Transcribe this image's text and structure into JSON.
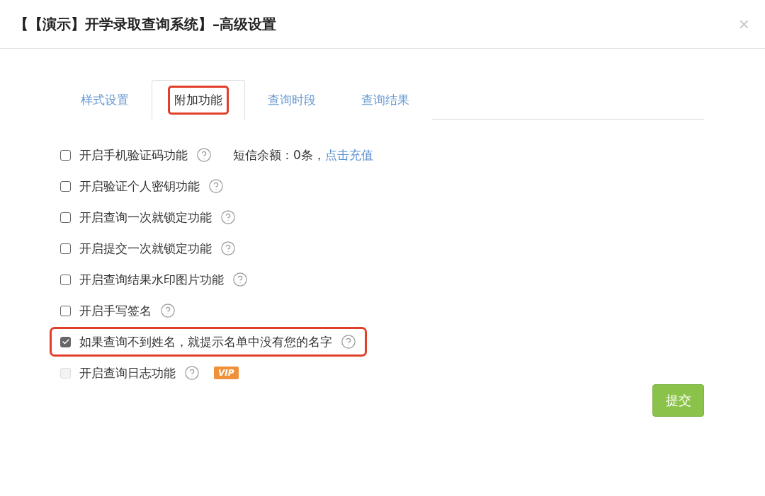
{
  "window": {
    "title": "【【演示】开学录取查询系统】–高级设置",
    "close": "×"
  },
  "tabs": [
    {
      "label": "样式设置",
      "selected": false,
      "highlighted": false
    },
    {
      "label": "附加功能",
      "selected": true,
      "highlighted": true
    },
    {
      "label": "查询时段",
      "selected": false,
      "highlighted": false
    },
    {
      "label": "查询结果",
      "selected": false,
      "highlighted": false
    }
  ],
  "options": [
    {
      "label": "开启手机验证码功能",
      "checked": false,
      "disabled": false,
      "highlighted": false,
      "note": "短信余额：0条，",
      "link": "点击充值"
    },
    {
      "label": "开启验证个人密钥功能",
      "checked": false,
      "disabled": false,
      "highlighted": false
    },
    {
      "label": "开启查询一次就锁定功能",
      "checked": false,
      "disabled": false,
      "highlighted": false
    },
    {
      "label": "开启提交一次就锁定功能",
      "checked": false,
      "disabled": false,
      "highlighted": false
    },
    {
      "label": "开启查询结果水印图片功能",
      "checked": false,
      "disabled": false,
      "highlighted": false
    },
    {
      "label": "开启手写签名",
      "checked": false,
      "disabled": false,
      "highlighted": false
    },
    {
      "label": "如果查询不到姓名，就提示名单中没有您的名字",
      "checked": true,
      "disabled": false,
      "highlighted": true
    },
    {
      "label": "开启查询日志功能",
      "checked": false,
      "disabled": true,
      "highlighted": false,
      "badge": "VIP"
    }
  ],
  "submit": "提交"
}
